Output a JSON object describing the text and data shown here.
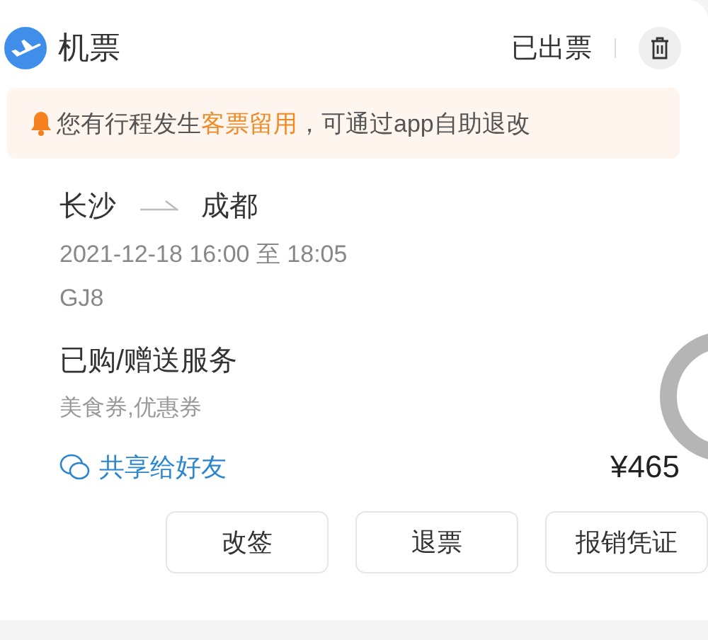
{
  "header": {
    "title": "机票",
    "status": "已出票"
  },
  "notice": {
    "before": "您有行程发生",
    "highlight": "客票留用",
    "after": "，可通过app自助退改"
  },
  "trip": {
    "from": "长沙",
    "to": "成都",
    "time": "2021-12-18 16:00 至 18:05",
    "flight": "GJ8"
  },
  "services": {
    "title": "已购/赠送服务",
    "items": "美食券,优惠券"
  },
  "share": {
    "label": "共享给好友"
  },
  "price": "¥465",
  "buttons": [
    "改签",
    "退票",
    "报销凭证"
  ]
}
